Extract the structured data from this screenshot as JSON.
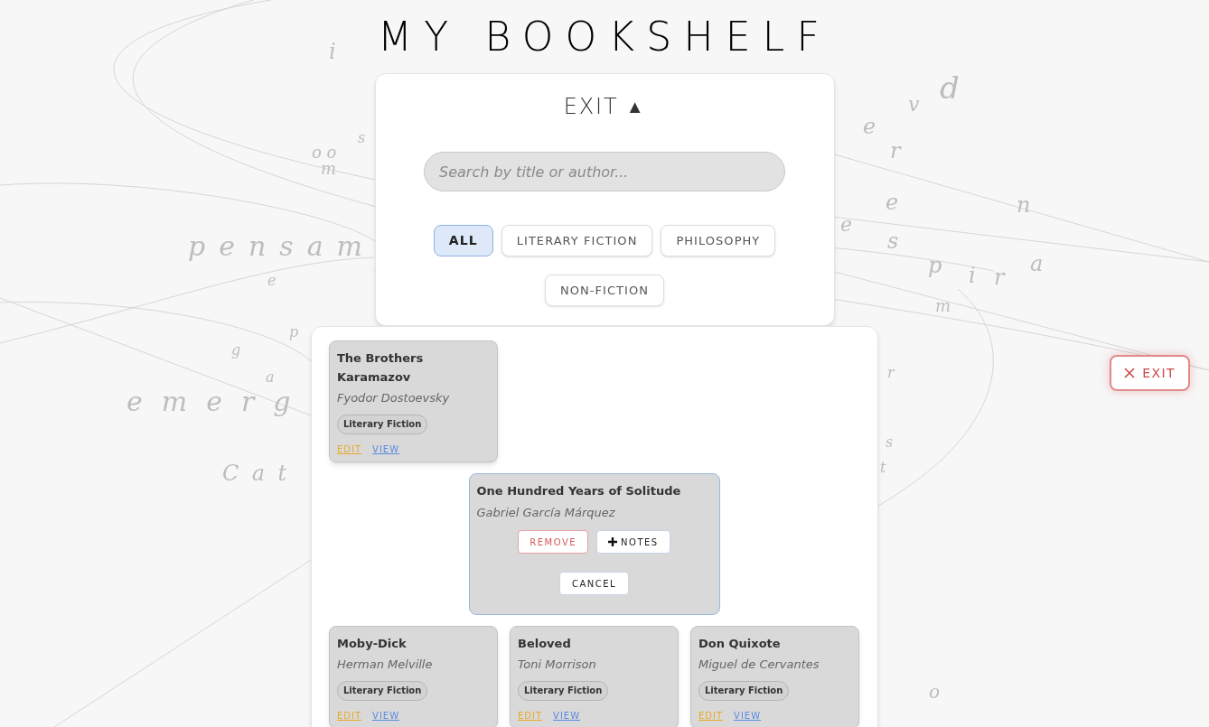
{
  "title": "MY BOOKSHELF",
  "background_words": [
    "pensam",
    "emerg",
    "Cat",
    "d",
    "v",
    "e",
    "r",
    "e",
    "n",
    "e",
    "s",
    "p",
    "i",
    "r",
    "a",
    "m",
    "o o",
    "m",
    "s",
    "e",
    "p",
    "g",
    "a",
    "i",
    "r",
    "s",
    "t",
    "o"
  ],
  "panel": {
    "toggle_label": "EXIT",
    "toggle_glyph": "▲",
    "search": {
      "placeholder": "Search by title or author..."
    },
    "filters": [
      {
        "label": "ALL",
        "selected": true
      },
      {
        "label": "LITERARY FICTION",
        "selected": false
      },
      {
        "label": "PHILOSOPHY",
        "selected": false
      },
      {
        "label": "NON-FICTION",
        "selected": false
      }
    ]
  },
  "books": [
    {
      "kind": "card",
      "title": "The Brothers Karamazov",
      "author": "Fyodor Dostoevsky",
      "tag": "Literary Fiction",
      "links": [
        "EDIT",
        "VIEW"
      ]
    },
    {
      "kind": "expanded",
      "title": "One Hundred Years of Solitude",
      "author": "Gabriel García Márquez",
      "actions": [
        "REMOVE",
        "NOTES"
      ],
      "cancel": "CANCEL"
    },
    {
      "kind": "card",
      "title": "Moby-Dick",
      "author": "Herman Melville",
      "tag": "Literary Fiction",
      "links": [
        "EDIT",
        "VIEW"
      ]
    },
    {
      "kind": "card",
      "title": "Beloved",
      "author": "Toni Morrison",
      "tag": "Literary Fiction",
      "links": [
        "EDIT",
        "VIEW"
      ]
    },
    {
      "kind": "card",
      "title": "Don Quixote",
      "author": "Miguel de Cervantes",
      "tag": "Literary Fiction",
      "links": [
        "EDIT",
        "VIEW"
      ]
    }
  ],
  "exit_button": "EXIT"
}
